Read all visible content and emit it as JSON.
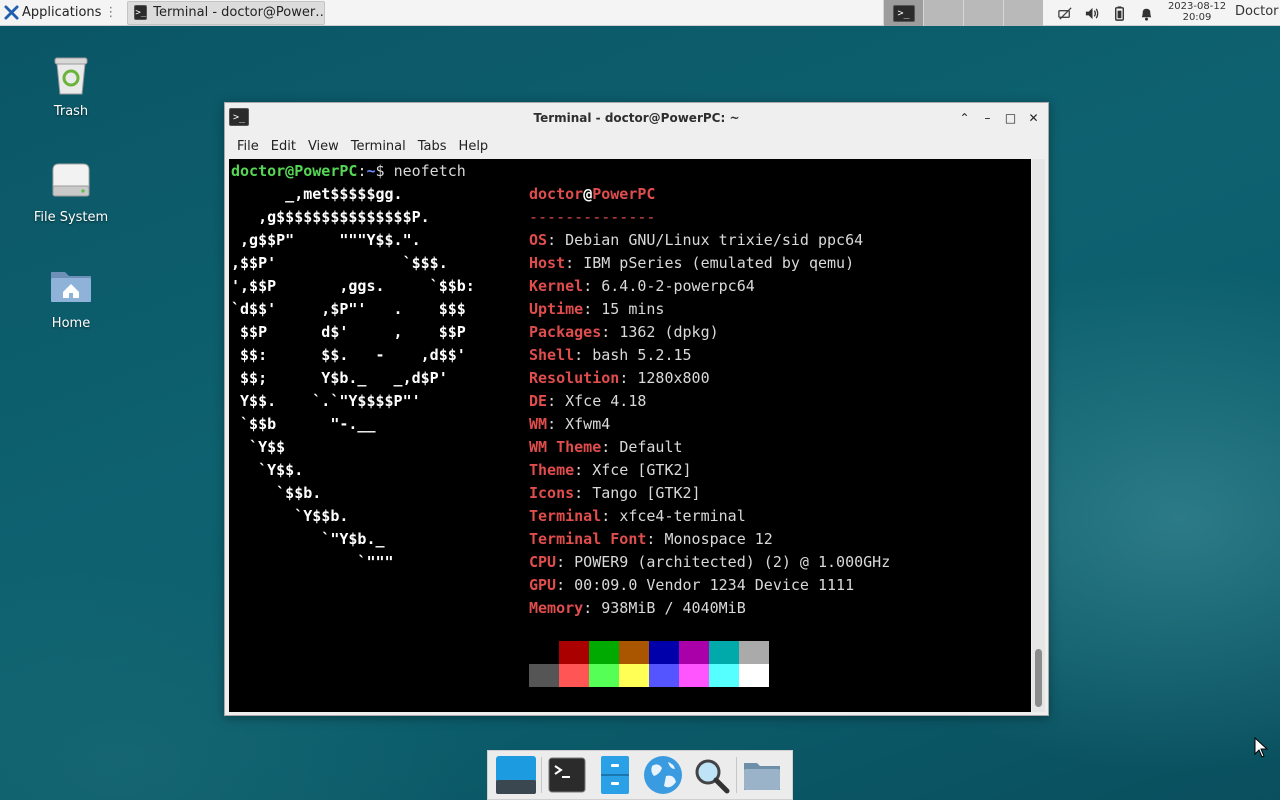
{
  "top_panel": {
    "applications_label": "Applications",
    "task_title": "Terminal - doctor@Power…",
    "date": "2023-08-12",
    "time": "20:09",
    "user": "Doctor"
  },
  "desktop_icons": [
    {
      "label": "Trash",
      "icon": "trash-icon"
    },
    {
      "label": "File System",
      "icon": "drive-icon"
    },
    {
      "label": "Home",
      "icon": "home-folder-icon"
    }
  ],
  "window": {
    "title": "Terminal - doctor@PowerPC: ~",
    "menu": [
      "File",
      "Edit",
      "View",
      "Terminal",
      "Tabs",
      "Help"
    ]
  },
  "terminal": {
    "prompt_user": "doctor@PowerPC",
    "prompt_path": "~",
    "prompt_symbol": "$",
    "command": "neofetch",
    "ascii": [
      "      _,met$$$$$gg.",
      "   ,g$$$$$$$$$$$$$$$P.",
      " ,g$$P\"     \"\"\"Y$$.\".",
      ",$$P'              `$$$.",
      "',$$P       ,ggs.     `$$b:",
      "`d$$'     ,$P\"'   .    $$$",
      " $$P      d$'     ,    $$P",
      " $$:      $$.   -    ,d$$'",
      " $$;      Y$b._   _,d$P'",
      " Y$$.    `.`\"Y$$$$P\"'",
      " `$$b      \"-.__",
      "  `Y$$",
      "   `Y$$.",
      "     `$$b.",
      "       `Y$$b.",
      "          `\"Y$b._",
      "              `\"\"\""
    ],
    "header_user": "doctor",
    "header_host": "PowerPC",
    "separator": "--------------",
    "info": [
      {
        "key": "OS",
        "value": "Debian GNU/Linux trixie/sid ppc64"
      },
      {
        "key": "Host",
        "value": "IBM pSeries (emulated by qemu)"
      },
      {
        "key": "Kernel",
        "value": "6.4.0-2-powerpc64"
      },
      {
        "key": "Uptime",
        "value": "15 mins"
      },
      {
        "key": "Packages",
        "value": "1362 (dpkg)"
      },
      {
        "key": "Shell",
        "value": "bash 5.2.15"
      },
      {
        "key": "Resolution",
        "value": "1280x800"
      },
      {
        "key": "DE",
        "value": "Xfce 4.18"
      },
      {
        "key": "WM",
        "value": "Xfwm4"
      },
      {
        "key": "WM Theme",
        "value": "Default"
      },
      {
        "key": "Theme",
        "value": "Xfce [GTK2]"
      },
      {
        "key": "Icons",
        "value": "Tango [GTK2]"
      },
      {
        "key": "Terminal",
        "value": "xfce4-terminal"
      },
      {
        "key": "Terminal Font",
        "value": "Monospace 12"
      },
      {
        "key": "CPU",
        "value": "POWER9 (architected) (2) @ 1.000GHz"
      },
      {
        "key": "GPU",
        "value": "00:09.0 Vendor 1234 Device 1111"
      },
      {
        "key": "Memory",
        "value": "938MiB / 4040MiB"
      }
    ],
    "palette_dark": [
      "#000000",
      "#aa0000",
      "#00aa00",
      "#aa5500",
      "#0000aa",
      "#aa00aa",
      "#00aaaa",
      "#aaaaaa"
    ],
    "palette_bright": [
      "#555555",
      "#ff5555",
      "#55ff55",
      "#ffff55",
      "#5555ff",
      "#ff55ff",
      "#55ffff",
      "#ffffff"
    ]
  },
  "dock": [
    "show-desktop-icon",
    "terminal-icon",
    "file-manager-icon",
    "web-browser-icon",
    "app-finder-icon",
    "folder-icon"
  ]
}
